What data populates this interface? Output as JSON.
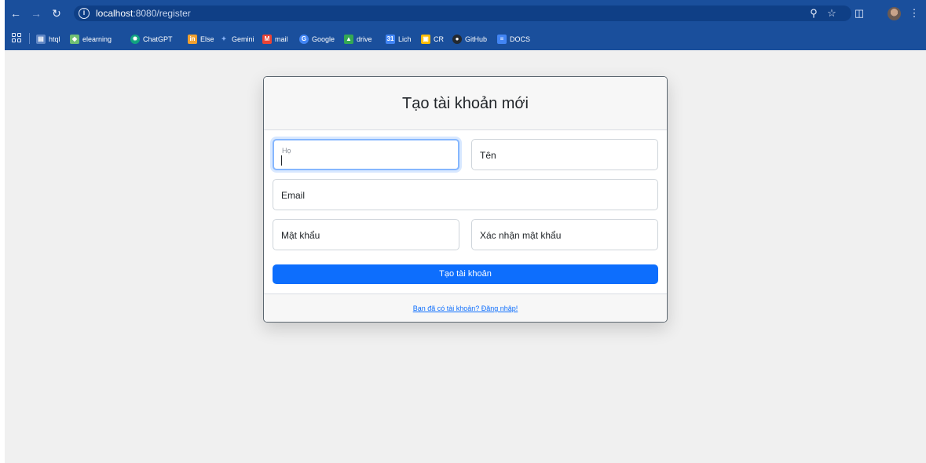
{
  "browser": {
    "url_host": "localhost",
    "url_rest": ":8080/register",
    "bookmarks": [
      {
        "label": "htql",
        "icon": "sheet-icon",
        "color": "#5f86c4"
      },
      {
        "label": "elearning",
        "icon": "diamond-icon",
        "color": "#6fbf73"
      },
      {
        "label": "ChatGPT",
        "icon": "chatgpt-icon",
        "color": "#10a37f"
      },
      {
        "label": "Else",
        "icon": "else-icon",
        "color": "#f0a030"
      },
      {
        "label": "Gemini",
        "icon": "gemini-icon",
        "color": "#8ab4f8"
      },
      {
        "label": "mail",
        "icon": "gmail-icon",
        "color": "#ea4335"
      },
      {
        "label": "Google",
        "icon": "google-icon",
        "color": "#4285f4"
      },
      {
        "label": "drive",
        "icon": "drive-icon",
        "color": "#34a853"
      },
      {
        "label": "Lich",
        "icon": "calendar-icon",
        "color": "#4285f4"
      },
      {
        "label": "CR",
        "icon": "image-icon",
        "color": "#fbbc04"
      },
      {
        "label": "GitHub",
        "icon": "github-icon",
        "color": "#24292f"
      },
      {
        "label": "DOCS",
        "icon": "docs-icon",
        "color": "#4285f4"
      }
    ]
  },
  "form": {
    "title": "Tạo tài khoản mới",
    "last_name_label": "Họ",
    "first_name_label": "Tên",
    "email_label": "Email",
    "password_label": "Mật khẩu",
    "confirm_password_label": "Xác nhận mật khẩu",
    "submit_label": "Tạo tài khoản",
    "login_link": "Bạn đã có tài khoản? Đăng nhập!"
  }
}
